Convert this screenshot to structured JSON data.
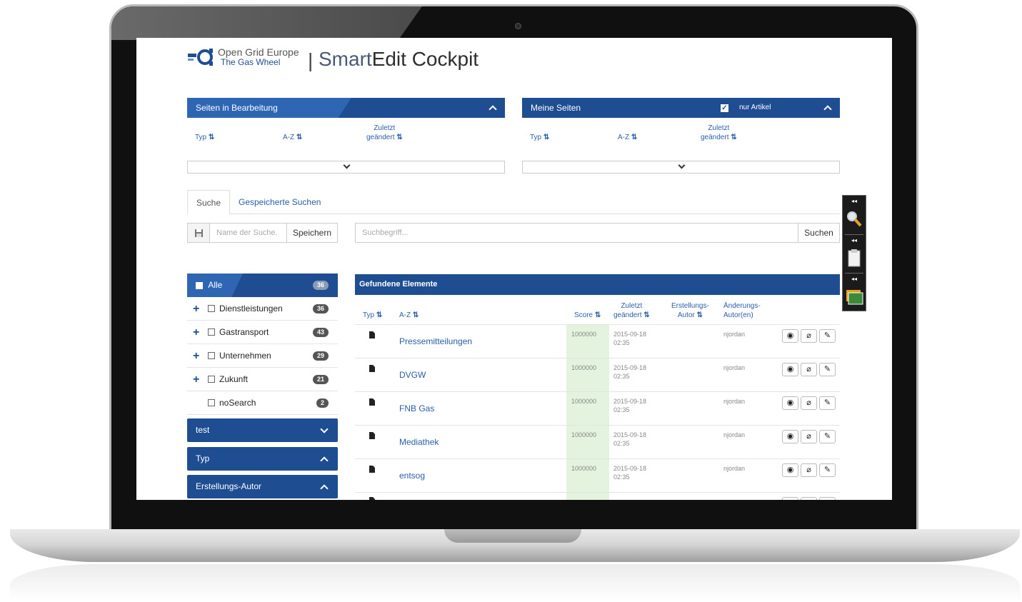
{
  "brand": {
    "company": "Open Grid Europe",
    "tagline": "The Gas Wheel",
    "separator": "|",
    "app_title_light": "Smart",
    "app_title_bold": "Edit Cockpit"
  },
  "panels": {
    "editing": {
      "title": "Seiten in Bearbeitung",
      "sort_typ": "Typ",
      "sort_az": "A-Z",
      "sort_changed_1": "Zuletzt",
      "sort_changed_2": "geändert"
    },
    "mine": {
      "title": "Meine Seiten",
      "checkbox_label": "nur Artikel",
      "sort_typ": "Typ",
      "sort_az": "A-Z",
      "sort_changed_1": "Zuletzt",
      "sort_changed_2": "geändert"
    }
  },
  "tabs": {
    "search": "Suche",
    "saved_prefix": "Gespeicherte",
    "saved_suffix": "Suchen"
  },
  "save_search": {
    "placeholder": "Name der Suche.",
    "button": "Speichern"
  },
  "search": {
    "placeholder": "Suchbegriff...",
    "button": "Suchen"
  },
  "facets": {
    "all": {
      "label": "Alle",
      "count": "36"
    },
    "items": [
      {
        "label": "Dienstleistungen",
        "count": "36",
        "expandable": true
      },
      {
        "label": "Gastransport",
        "count": "43",
        "expandable": true
      },
      {
        "label": "Unternehmen",
        "count": "29",
        "expandable": true
      },
      {
        "label": "Zukunft",
        "count": "21",
        "expandable": true
      },
      {
        "label": "noSearch",
        "count": "2",
        "expandable": false
      }
    ],
    "groups": [
      {
        "label": "test",
        "expanded": false
      },
      {
        "label": "Typ",
        "expanded": true
      },
      {
        "label": "Erstellungs-Autor",
        "expanded": true
      }
    ]
  },
  "results": {
    "title": "Gefundene Elemente",
    "columns": {
      "typ": "Typ",
      "az": "A-Z",
      "score": "Score",
      "changed_1": "Zuletzt",
      "changed_2": "geändert",
      "creator_1": "Erstellungs-",
      "creator_2": "Autor",
      "editors_1": "Änderungs-",
      "editors_2": "Autor(en)"
    },
    "rows": [
      {
        "name": "Pressemitteilungen",
        "score": "1000000",
        "date": "2015-09-18",
        "time": "02:35",
        "editor": "njordan"
      },
      {
        "name": "DVGW",
        "score": "1000000",
        "date": "2015-09-18",
        "time": "02:35",
        "editor": "njordan"
      },
      {
        "name": "FNB Gas",
        "score": "1000000",
        "date": "2015-09-18",
        "time": "02:35",
        "editor": "njordan"
      },
      {
        "name": "Mediathek",
        "score": "1000000",
        "date": "2015-09-18",
        "time": "02:35",
        "editor": "njordan"
      },
      {
        "name": "entsog",
        "score": "1000000",
        "date": "2015-09-18",
        "time": "02:35",
        "editor": "njordan"
      }
    ]
  },
  "colors": {
    "primary": "#1e4d92",
    "accent": "#2f66b3",
    "link": "#2b5ea8",
    "score_bg": "#e3f3de"
  },
  "icons": {
    "floppy": "save-icon",
    "view": "eye-icon",
    "attach": "paperclip-icon",
    "edit": "pencil-icon",
    "dock": [
      "search-magnifier-icon",
      "clipboard-icon",
      "gallery-icon"
    ]
  }
}
